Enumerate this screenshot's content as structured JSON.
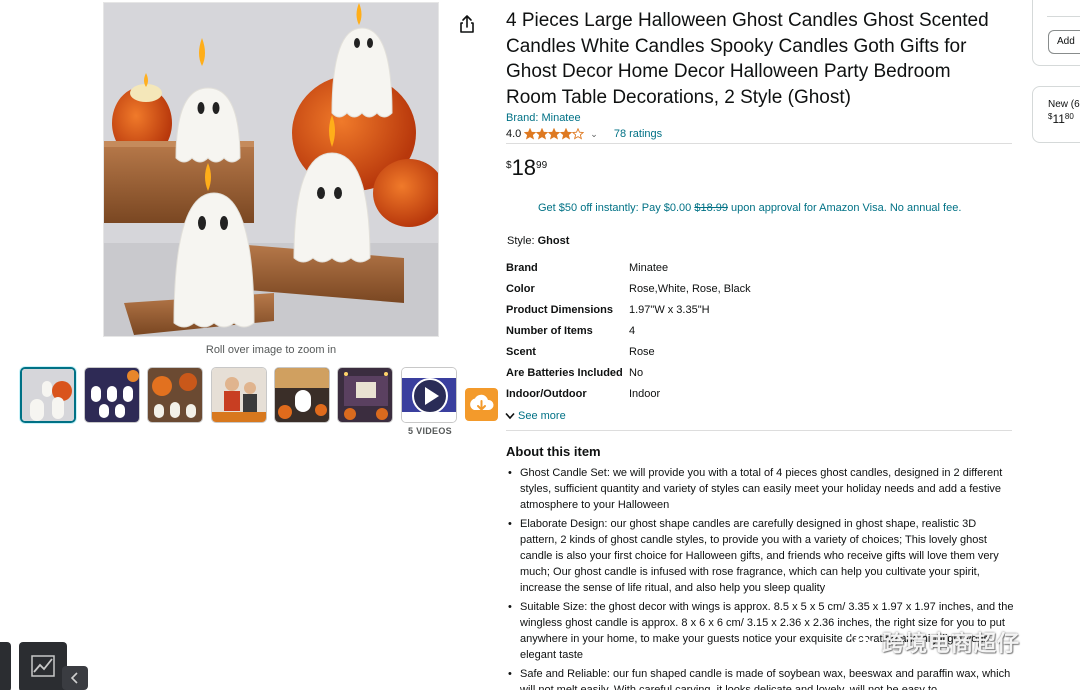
{
  "product": {
    "title": "4 Pieces Large Halloween Ghost Candles Ghost Scented Candles White Candles Spooky Candles Goth Gifts for Ghost Decor Home Decor Halloween Party Bedroom Room Table Decorations, 2 Style (Ghost)",
    "brand_link": "Brand: Minatee",
    "rating": "4.0",
    "rating_stars": 4,
    "ratings_count": "78 ratings",
    "price": {
      "currency": "$",
      "whole": "18",
      "fraction": "99"
    },
    "promo": {
      "prefix": "Get $50 off instantly: Pay $0.00 ",
      "strike": "$18.99",
      "suffix": " upon approval for Amazon Visa. No annual fee."
    },
    "style_label": "Style: ",
    "style_value": "Ghost"
  },
  "gallery": {
    "zoom_hint": "Roll over image to zoom in",
    "videos_label": "5 VIDEOS",
    "thumbnail_count": 7
  },
  "specs": [
    {
      "key": "Brand",
      "value": "Minatee"
    },
    {
      "key": "Color",
      "value": "Rose,White, Rose, Black"
    },
    {
      "key": "Product Dimensions",
      "value": "1.97\"W x 3.35\"H"
    },
    {
      "key": "Number of Items",
      "value": "4"
    },
    {
      "key": "Scent",
      "value": "Rose"
    },
    {
      "key": "Are Batteries Included",
      "value": "No"
    },
    {
      "key": "Indoor/Outdoor",
      "value": "Indoor"
    }
  ],
  "see_more": "See more",
  "about": {
    "title": "About this item",
    "bullets": [
      "Ghost Candle Set: we will provide you with a total of 4 pieces ghost candles, designed in 2 different styles, sufficient quantity and variety of styles can easily meet your holiday needs and add a festive atmosphere to your Halloween",
      "Elaborate Design: our ghost shape candles are carefully designed in ghost shape, realistic 3D pattern, 2 kinds of ghost candle styles, to provide you with a variety of choices; This lovely ghost candle is also your first choice for Halloween gifts, and friends who receive gifts will love them very much; Our ghost candle is infused with rose fragrance, which can help you cultivate your spirit, increase the sense of life ritual, and also help you sleep quality",
      "Suitable Size: the ghost decor with wings is approx. 8.5 x 5 x 5 cm/ 3.35 x 1.97 x 1.97 inches, and the wingless ghost candle is approx. 8 x 6 x 6 cm/ 3.15 x 2.36 x 2.36 inches, the right size for you to put anywhere in your home, to make your guests notice your exquisite decoration and highlight your elegant taste",
      "Safe and Reliable: our fun shaped candle is made of soybean wax, beeswax and paraffin wax, which will not melt easily. With careful carving, it looks delicate and lovely, will not be easy to"
    ]
  },
  "side": {
    "add_button": "Add",
    "new_label": "New (6",
    "price_currency": "$",
    "price_whole": "11",
    "price_fraction": "80"
  },
  "watermark": "跨境电商超仔",
  "colors": {
    "link": "#007185",
    "star": "#de7921",
    "fab": "#f39a2b"
  }
}
